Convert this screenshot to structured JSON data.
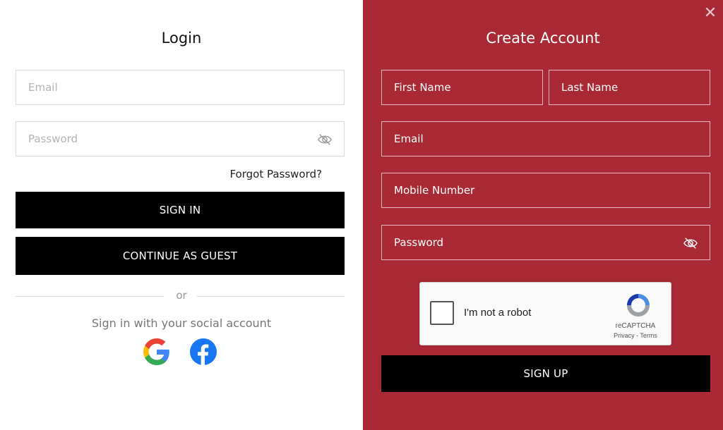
{
  "login": {
    "title": "Login",
    "email_placeholder": "Email",
    "password_placeholder": "Password",
    "forgot_label": "Forgot Password?",
    "sign_in_label": "SIGN IN",
    "guest_label": "CONTINUE AS GUEST",
    "or_label": "or",
    "social_text": "Sign in with your social account",
    "social_icons": [
      "google-icon",
      "facebook-icon"
    ]
  },
  "register": {
    "title": "Create Account",
    "first_name_placeholder": "First Name",
    "last_name_placeholder": "Last Name",
    "email_placeholder": "Email",
    "mobile_placeholder": "Mobile Number",
    "password_placeholder": "Password",
    "captcha_label": "I'm not a robot",
    "captcha_brand": "reCAPTCHA",
    "captcha_links": "Privacy - Terms",
    "sign_up_label": "SIGN UP"
  },
  "colors": {
    "accent": "#a92a35",
    "button": "#000000"
  }
}
